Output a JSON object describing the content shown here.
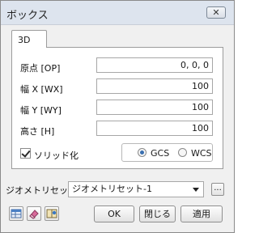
{
  "window": {
    "title": "ボックス",
    "close_glyph": "✕"
  },
  "tab": {
    "label": "3D"
  },
  "fields": {
    "origin": {
      "label": "原点 [OP]",
      "value": "0, 0, 0"
    },
    "width_x": {
      "label": "幅 X [WX]",
      "value": "100"
    },
    "width_y": {
      "label": "幅 Y [WY]",
      "value": "100"
    },
    "height": {
      "label": "高さ [H]",
      "value": "100"
    }
  },
  "solid": {
    "label": "ソリッド化",
    "checked": true
  },
  "coord": {
    "gcs_label": "GCS",
    "wcs_label": "WCS",
    "selected": "GCS"
  },
  "preset": {
    "label": "ジオメトリセット",
    "value": "ジオメトリセット-1",
    "browse_label": "..."
  },
  "buttons": {
    "ok": "OK",
    "close": "閉じる",
    "apply": "適用"
  },
  "icons": [
    "table-icon",
    "eraser-icon",
    "help-book-icon"
  ],
  "colors": {
    "title_bar": "#dde4ee",
    "radio_accent": "#3a6fb0",
    "dialog_bg": "#f0f0f0"
  }
}
